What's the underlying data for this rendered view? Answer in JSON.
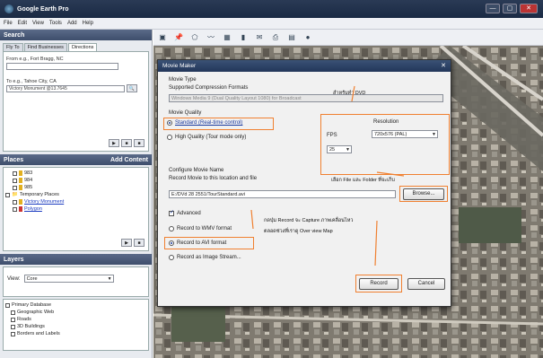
{
  "window": {
    "title": "Google Earth Pro",
    "buttons": [
      "—",
      "▢",
      "✕"
    ]
  },
  "menu": [
    "File",
    "Edit",
    "View",
    "Tools",
    "Add",
    "Help"
  ],
  "search": {
    "header": "Search",
    "tabs": [
      "Fly To",
      "Find Businesses",
      "Directions"
    ],
    "from_label": "From e.g., Fort Bragg, NC",
    "to_label": "To e.g., Tahoe City, CA",
    "to_value": "Victory Monument @13.7645"
  },
  "places": {
    "header": "Places",
    "add_content": "Add Content",
    "items": [
      "983",
      "984",
      "985"
    ],
    "temporary": "Temporary Places",
    "victory": "Victory Monument",
    "polygon": "Polygon"
  },
  "layers": {
    "header": "Layers",
    "view_label": "View:",
    "view_value": "Core",
    "items": [
      "Primary Database",
      "Geographic Web",
      "Roads",
      "3D Buildings",
      "Borders and Labels"
    ]
  },
  "dialog": {
    "title": "Movie Maker",
    "movie_type": "Movie Type",
    "compression_label": "Supported Compression Formats",
    "compression_value": "Windows Media 9 (Dual Quality Layout 1080) for Broadcast",
    "movie_quality": "Movie Quality",
    "standard": "Standard (Real-time control)",
    "high_quality": "High Quality (Tour mode only)",
    "resolution_label": "Resolution",
    "resolution_value": "720x576 (PAL)",
    "fps_label": "FPS",
    "fps_value": "25",
    "configure_label": "Configure Movie Name",
    "record_to_label": "Record Movie to this location and file",
    "file_path": "E:/DVd 28 2551/TourStandard.avi",
    "browse": "Browse...",
    "advanced": "Advanced",
    "record_wmv": "Record to WMV format",
    "record_avi": "Record to AVI format",
    "record_image": "Record as Image Stream...",
    "record_btn": "Record",
    "cancel_btn": "Cancel"
  },
  "annotations": {
    "dvd": "สำหรับทำ DVD",
    "file_folder": "เลือก File และ Folder ที่จะเก็บ",
    "record_capture_line1": "กดปุ่ม Record จะ Capture ภาพเคลื่อนไหว",
    "record_capture_line2": "ตลอดช่วงที่เราดู Over view Map",
    "highlight_color": "#f08030"
  }
}
